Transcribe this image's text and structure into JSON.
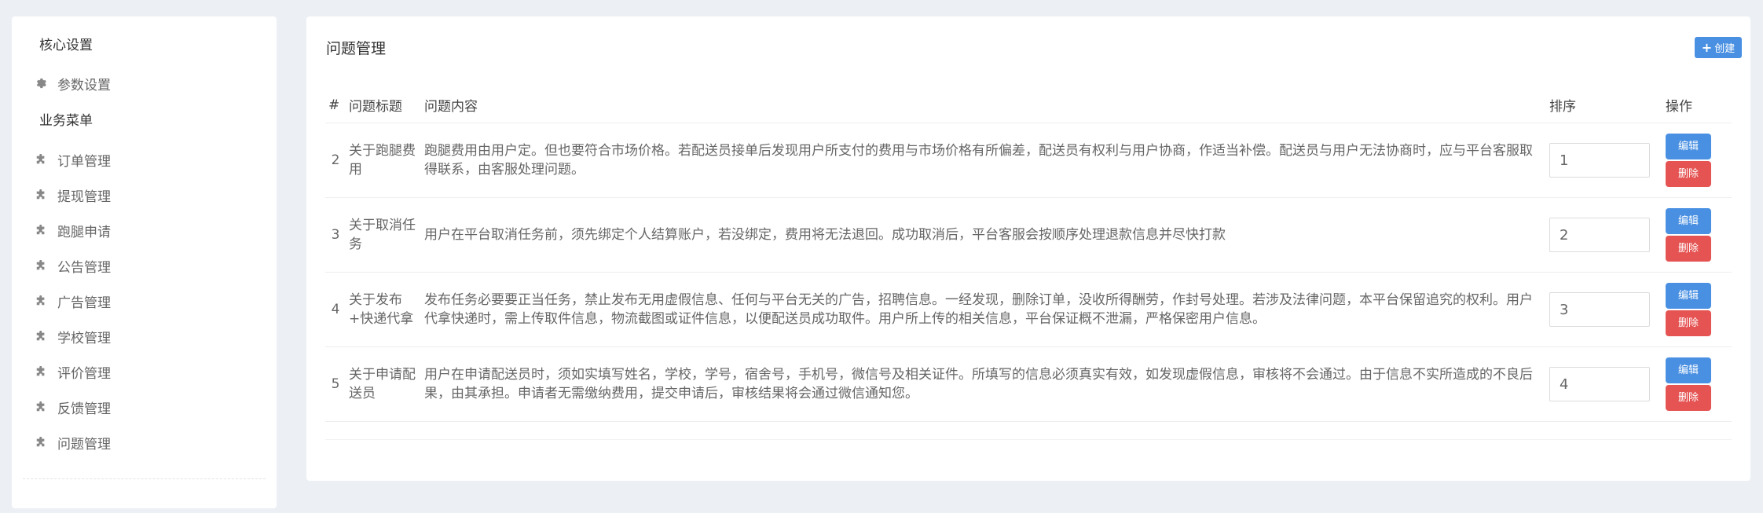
{
  "sidebar": {
    "core_heading": "核心设置",
    "core_items": [
      {
        "label": "参数设置",
        "icon": "gear-icon"
      }
    ],
    "business_heading": "业务菜单",
    "business_items": [
      {
        "label": "订单管理",
        "icon": "puzzle-icon"
      },
      {
        "label": "提现管理",
        "icon": "puzzle-icon"
      },
      {
        "label": "跑腿申请",
        "icon": "puzzle-icon"
      },
      {
        "label": "公告管理",
        "icon": "puzzle-icon"
      },
      {
        "label": "广告管理",
        "icon": "puzzle-icon"
      },
      {
        "label": "学校管理",
        "icon": "puzzle-icon"
      },
      {
        "label": "评价管理",
        "icon": "puzzle-icon"
      },
      {
        "label": "反馈管理",
        "icon": "puzzle-icon"
      },
      {
        "label": "问题管理",
        "icon": "puzzle-icon"
      }
    ]
  },
  "main": {
    "title": "问题管理",
    "create_label": "创建",
    "columns": {
      "id": "#",
      "title": "问题标题",
      "content": "问题内容",
      "sort": "排序",
      "action": "操作"
    },
    "edit_label": "编辑",
    "delete_label": "删除",
    "rows": [
      {
        "id": "2",
        "title": "关于跑腿费用",
        "content": "跑腿费用由用户定。但也要符合市场价格。若配送员接单后发现用户所支付的费用与市场价格有所偏差，配送员有权利与用户协商，作适当补偿。配送员与用户无法协商时，应与平台客服取得联系，由客服处理问题。",
        "sort": "1"
      },
      {
        "id": "3",
        "title": "关于取消任务",
        "content": "用户在平台取消任务前，须先绑定个人结算账户，若没绑定，费用将无法退回。成功取消后，平台客服会按顺序处理退款信息并尽快打款",
        "sort": "2"
      },
      {
        "id": "4",
        "title": "关于发布+快递代拿",
        "content": "发布任务必要要正当任务，禁止发布无用虚假信息、任何与平台无关的广告，招聘信息。一经发现，删除订单，没收所得酬劳，作封号处理。若涉及法律问题，本平台保留追究的权利。用户代拿快递时，需上传取件信息，物流截图或证件信息，以便配送员成功取件。用户所上传的相关信息，平台保证概不泄漏，严格保密用户信息。",
        "sort": "3"
      },
      {
        "id": "5",
        "title": "关于申请配送员",
        "content": "用户在申请配送员时，须如实填写姓名，学校，学号，宿舍号，手机号，微信号及相关证件。所填写的信息必须真实有效，如发现虚假信息，审核将不会通过。由于信息不实所造成的不良后果，由其承担。申请者无需缴纳费用，提交申请后，审核结果将会通过微信通知您。",
        "sort": "4"
      }
    ]
  }
}
